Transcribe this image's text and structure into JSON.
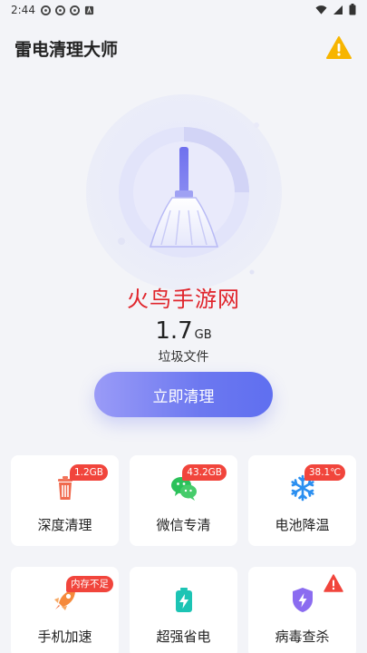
{
  "status_bar": {
    "time": "2:44"
  },
  "header": {
    "title": "雷电清理大师"
  },
  "hero": {
    "watermark": "火鸟手游网",
    "junk_size": "1.7",
    "junk_unit": "GB",
    "junk_label": "垃圾文件",
    "clean_button": "立即清理"
  },
  "cards": [
    {
      "label": "深度清理",
      "badge": "1.2GB",
      "icon": "trash-icon"
    },
    {
      "label": "微信专清",
      "badge": "43.2GB",
      "icon": "wechat-icon"
    },
    {
      "label": "电池降温",
      "badge": "38.1℃",
      "icon": "snowflake-icon"
    },
    {
      "label": "手机加速",
      "badge": "内存不足",
      "icon": "rocket-icon"
    },
    {
      "label": "超强省电",
      "badge": "",
      "icon": "battery-icon"
    },
    {
      "label": "病毒查杀",
      "badge": "",
      "icon": "shield-icon"
    }
  ],
  "colors": {
    "accent": "#6c78f0",
    "badge": "#f1453c",
    "warning": "#f7b500"
  }
}
